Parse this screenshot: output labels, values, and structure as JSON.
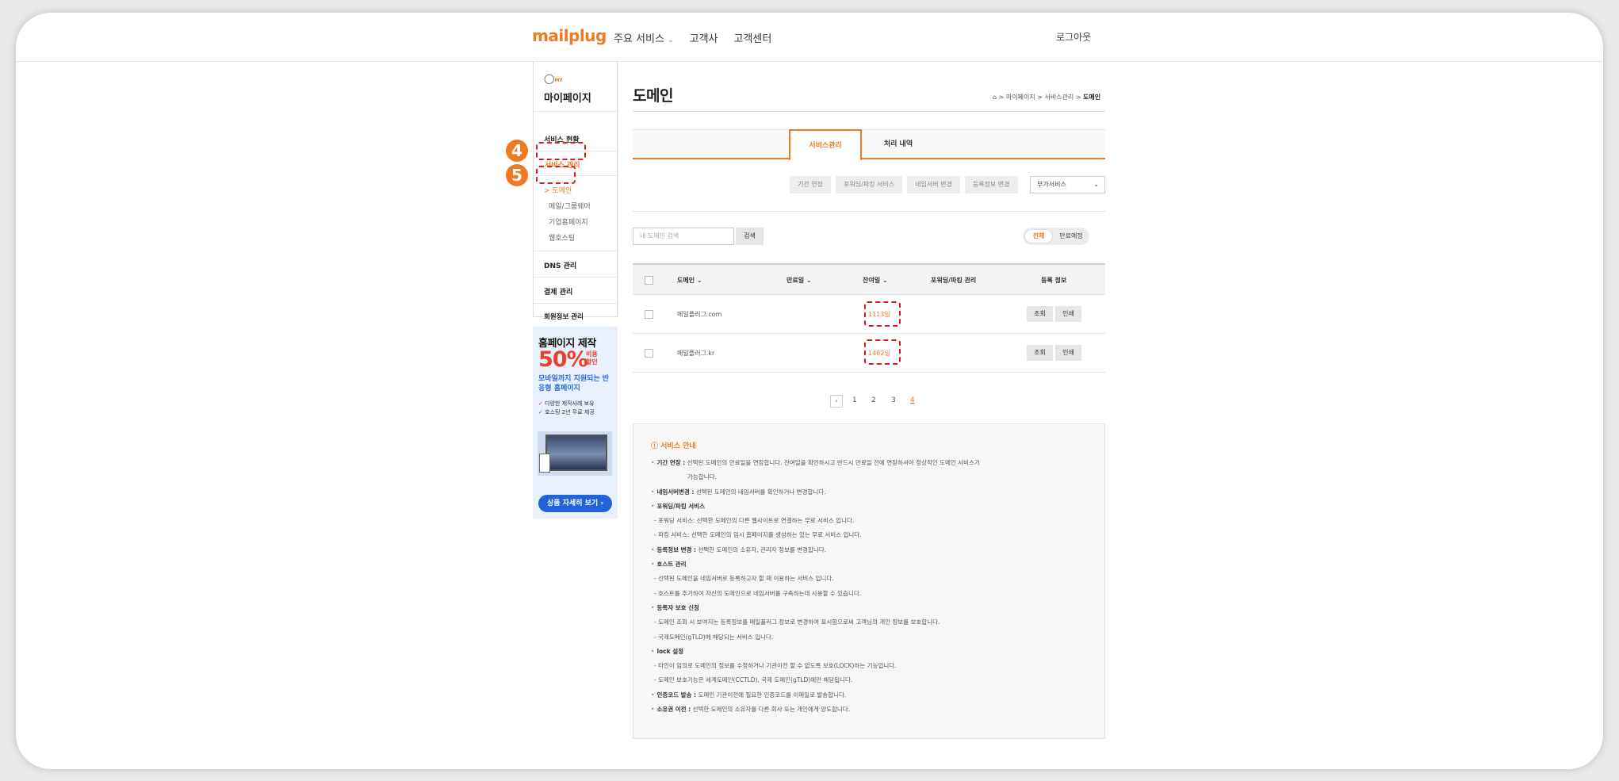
{
  "header": {
    "logo": "mailplug",
    "nav": [
      "주요 서비스",
      "고객사",
      "고객센터"
    ],
    "nav_caret": "⌄",
    "logout": "로그아웃"
  },
  "sidebar": {
    "my_label": "MY",
    "title": "마이페이지",
    "items": [
      "서비스 현황",
      "서비스 관리",
      "DNS 관리",
      "결제 관리",
      "회원정보 관리"
    ],
    "sub_active": "> 도메인",
    "sub_items": [
      "메일/그룹웨어",
      "기업홈페이지",
      "웹호스팅"
    ],
    "badges": [
      "4",
      "5"
    ]
  },
  "ad": {
    "title": "홈페이지 제작",
    "percent": "50%",
    "discount": "비용\n할인",
    "subtitle": "모바일까지 지원되는 반응형 홈페이지",
    "features": [
      "다양한 제작사례 보유",
      "호스팅 2년 무료 제공"
    ],
    "button": "상품 자세히 보기 ›"
  },
  "main": {
    "title": "도메인",
    "breadcrumb_path": "⌂ > 마이페이지 > 서비스관리 > ",
    "breadcrumb_current": "도메인",
    "tabs": [
      "서비스관리",
      "처리 내역"
    ],
    "actions": [
      "기간 연장",
      "포워딩/파킹 서비스",
      "네임서버 변경",
      "등록정보 변경"
    ],
    "addon_select": "부가서비스",
    "search_placeholder": "내 도메인 검색",
    "search_button": "검색",
    "filter_all": "전체",
    "filter_expiring": "만료예정"
  },
  "table": {
    "headers": [
      "도메인 ⌄",
      "만료일 ⌄",
      "잔여일 ⌄",
      "포워딩/파킹 관리",
      "등록 정보"
    ],
    "rows": [
      {
        "domain": "메일플러그.com",
        "expire": "",
        "remaining": "1113일",
        "view": "조회",
        "print": "인쇄"
      },
      {
        "domain": "메일플러그.kr",
        "expire": "",
        "remaining": "1482일",
        "view": "조회",
        "print": "인쇄"
      }
    ]
  },
  "pagination": {
    "prev": "‹",
    "pages": [
      "1",
      "2",
      "3",
      "4"
    ],
    "current": "4"
  },
  "info": {
    "title": "ⓘ 서비스 안내",
    "lines": [
      {
        "bullet": true,
        "bold": "기간 연장 :",
        "text": " 선택된 도메인의 만료일을 연장합니다. 잔여일을 확인하시고 반드시 만료일 전에 연장하셔야 정상적인 도메인 서비스가"
      },
      {
        "indent": true,
        "text": "가능합니다."
      },
      {
        "bullet": true,
        "bold": "네임서버변경 :",
        "text": " 선택된 도메인의 네임서버를 확인하거나 변경합니다."
      },
      {
        "bullet": true,
        "bold": "포워딩/파킹 서비스",
        "text": ""
      },
      {
        "sub": true,
        "text": "- 포워딩 서비스: 선택한 도메인의 다른 웹사이트로 연결하는 무료 서비스 입니다."
      },
      {
        "sub": true,
        "text": "- 파킹 서비스: 선택한 도메인의 임시 홈페이지를 생성하는 있는 무료 서비스 입니다."
      },
      {
        "bullet": true,
        "bold": "등록정보 변경 :",
        "text": " 선택한 도메인의 소유자, 관리자 정보를 변경합니다."
      },
      {
        "bullet": true,
        "bold": "호스트 관리",
        "text": ""
      },
      {
        "sub": true,
        "text": "- 선택된 도메인을 네임서버로 등록하고자 할 때 이용하는 서비스 입니다."
      },
      {
        "sub": true,
        "text": "- 호스트를 추가하여 자신의 도메인으로 네임서버를 구축하는데 사용할 수 있습니다."
      },
      {
        "bullet": true,
        "bold": "등록자 보호 신청",
        "text": ""
      },
      {
        "sub": true,
        "text": "- 도메인 조회 시 보여지는 등록정보를 메일플러그 정보로 변경하여 표시함으로써 고객님의 개인 정보를 보호합니다."
      },
      {
        "sub": true,
        "text": "- 국제도메인(gTLD)에 해당되는 서비스 입니다."
      },
      {
        "bullet": true,
        "bold": "lock 설정",
        "text": ""
      },
      {
        "sub": true,
        "text": "- 타인이 임의로 도메인의 정보를 수정하거나 기관이전 할 수 없도록 보호(LOCK)하는 기능입니다."
      },
      {
        "sub": true,
        "text": "- 도메인 보호기능은 세계도메인(CCTLD), 국제 도메인(gTLD)에만 해당됩니다."
      },
      {
        "bullet": true,
        "bold": "인증코드 발송 :",
        "text": " 도메인 기관이전에 필요한 인증코드를 이메일로 발송합니다."
      },
      {
        "bullet": true,
        "bold": "소유권 이전 :",
        "text": " 선택한 도메인의 소유자를 다른 회사 또는 개인에게 양도합니다."
      }
    ]
  },
  "colors": {
    "accent": "#f07a22",
    "annotation": "#d81e1e",
    "ad_blue": "#2462d9"
  }
}
